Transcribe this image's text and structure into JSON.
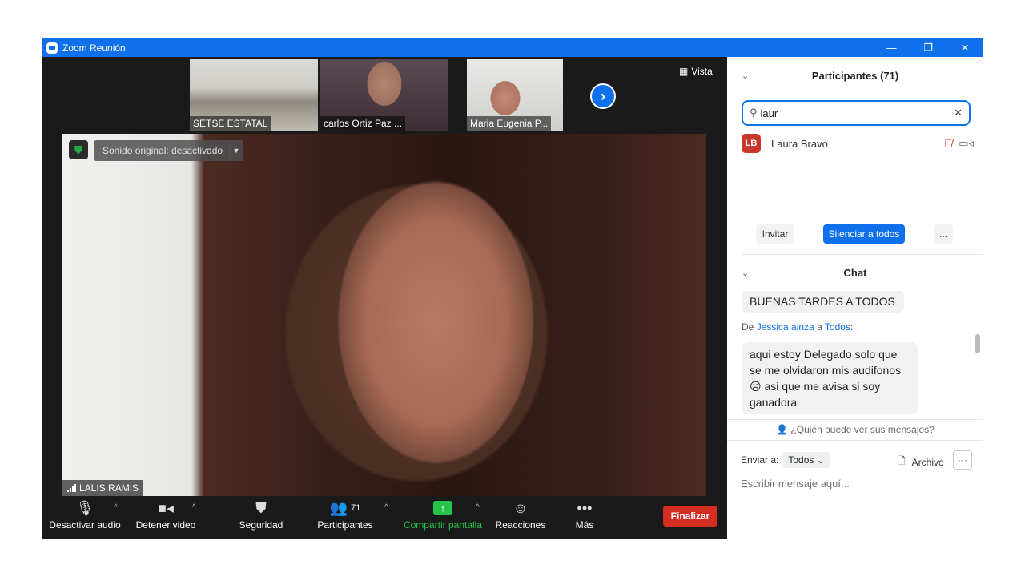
{
  "window": {
    "title": "Zoom Reunión",
    "minimize_icon": "—",
    "maximize_icon": "❐",
    "close_icon": "✕"
  },
  "thumbnails": [
    {
      "name": "SETSE ESTATAL"
    },
    {
      "name": "carlos Ortiz Paz ..."
    },
    {
      "name": "Maria Eugenia P..."
    }
  ],
  "view_button": {
    "label": "Vista"
  },
  "main_video": {
    "sound_label": "Sonido original: desactivado",
    "speaker_name": "LALIS RAMIS"
  },
  "toolbar": {
    "mute": "Desactivar audio",
    "video": "Detener video",
    "security": "Seguridad",
    "participants": "Participantes",
    "participants_count": "71",
    "share": "Compartir pantalla",
    "reactions": "Reacciones",
    "more": "Más",
    "end": "Finalizar"
  },
  "participants_panel": {
    "title": "Participantes (71)",
    "search_value": "laur",
    "participants": [
      {
        "initials": "LB",
        "name": "Laura Bravo"
      }
    ],
    "invite": "Invitar",
    "mute_all": "Silenciar a todos",
    "more": "..."
  },
  "chat": {
    "title": "Chat",
    "messages": [
      {
        "text": "BUENAS TARDES A TODOS"
      },
      {
        "prefix": "De",
        "from": "Jessica ainza",
        "to_word": "a",
        "to": "Todos",
        "suffix": ":",
        "text": "aqui estoy Delegado solo que se me olvidaron mis audifonos ☹ asi que me avisa si soy ganadora"
      }
    ],
    "who_can_see": "¿Quién puede ver sus mensajes?",
    "send_to_label": "Enviar a:",
    "send_to_value": "Todos",
    "file": "Archivo",
    "more": "···",
    "input_placeholder": "Escribir mensaje aquí..."
  },
  "colors": {
    "zoom_blue": "#0e71eb",
    "end_red": "#d42d22",
    "share_green": "#24c44b",
    "secure_green": "#28a745"
  }
}
